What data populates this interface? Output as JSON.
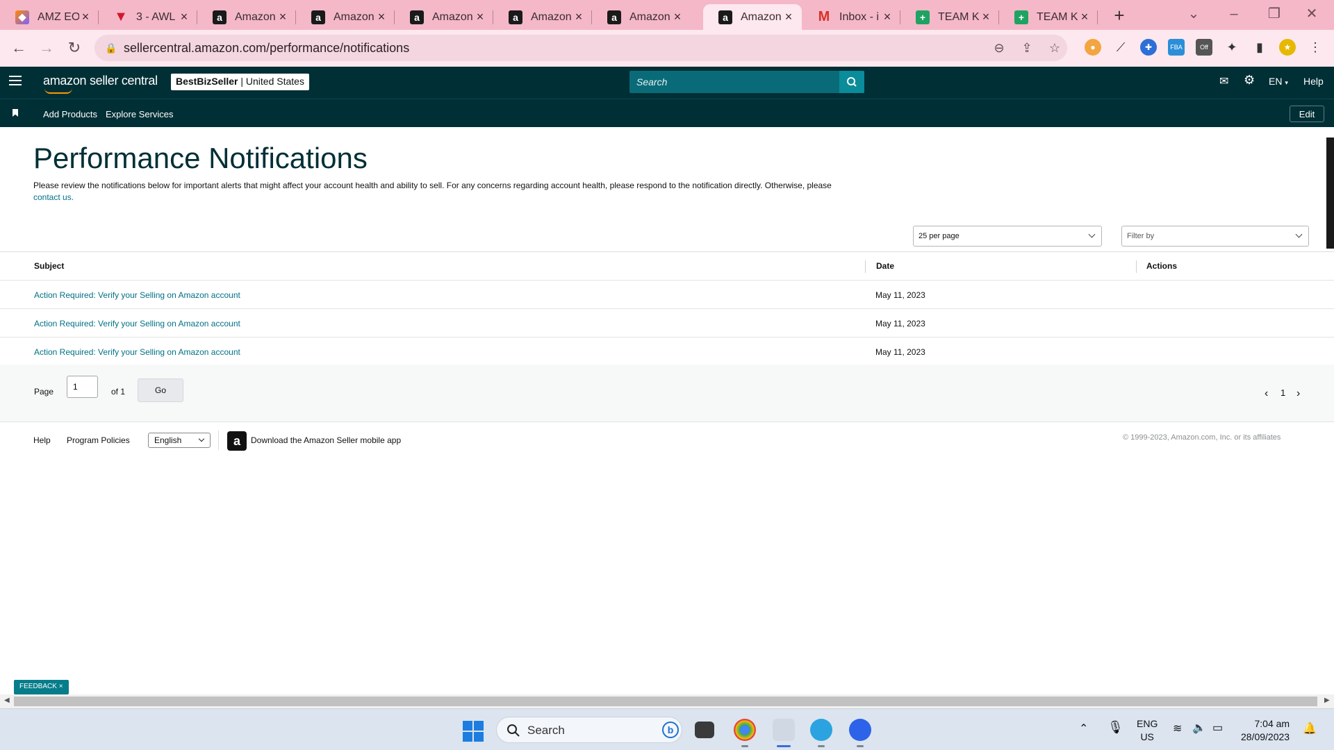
{
  "browser": {
    "tabs": [
      {
        "title": "AMZ EO",
        "favicon": "clickup-icon"
      },
      {
        "title": "3 - AWL",
        "favicon": "triangle-app-icon"
      },
      {
        "title": "Amazon",
        "favicon": "amazon-icon"
      },
      {
        "title": "Amazon",
        "favicon": "amazon-icon"
      },
      {
        "title": "Amazon",
        "favicon": "amazon-icon"
      },
      {
        "title": "Amazon",
        "favicon": "amazon-icon"
      },
      {
        "title": "Amazon",
        "favicon": "amazon-icon"
      },
      {
        "title": "Amazon",
        "favicon": "amazon-icon",
        "active": true
      },
      {
        "title": "Inbox - i",
        "favicon": "gmail-icon"
      },
      {
        "title": "TEAM KI",
        "favicon": "sheets-icon"
      },
      {
        "title": "TEAM KI",
        "favicon": "sheets-icon"
      }
    ],
    "url": "sellercentral.amazon.com/performance/notifications",
    "extension_badge": "Off",
    "accent_color": "#f4b8c9"
  },
  "header": {
    "logo_text": "amazon seller central",
    "store_name": "BestBizSeller",
    "store_region": "United States",
    "search_placeholder": "Search",
    "language": "EN",
    "help_label": "Help"
  },
  "subnav": {
    "items": [
      "Add Products",
      "Explore Services"
    ],
    "edit_label": "Edit"
  },
  "main": {
    "title": "Performance Notifications",
    "intro": "Please review the notifications below for important alerts that might affect your account health and ability to sell. For any concerns regarding account health, please respond to the notification directly. Otherwise, please",
    "contact_link": "contact us.",
    "per_page": "25 per page",
    "filter_placeholder": "Filter by",
    "columns": {
      "subject": "Subject",
      "date": "Date",
      "actions": "Actions"
    },
    "rows": [
      {
        "subject": "Action Required: Verify your Selling on Amazon account",
        "date": "May 11, 2023"
      },
      {
        "subject": "Action Required: Verify your Selling on Amazon account",
        "date": "May 11, 2023"
      },
      {
        "subject": "Action Required: Verify your Selling on Amazon account",
        "date": "May 11, 2023"
      }
    ],
    "pager": {
      "page_label": "Page",
      "page_value": "1",
      "of_label": "of 1",
      "go_label": "Go",
      "current_page": "1"
    }
  },
  "footer": {
    "help": "Help",
    "policies": "Program Policies",
    "language": "English",
    "app_text": "Download the Amazon Seller mobile app",
    "copyright": "© 1999-2023, Amazon.com, Inc. or its affiliates"
  },
  "feedback_label": "FEEDBACK",
  "taskbar": {
    "search_label": "Search",
    "lang_line1": "ENG",
    "lang_line2": "US",
    "time": "7:04 am",
    "date": "28/09/2023"
  }
}
